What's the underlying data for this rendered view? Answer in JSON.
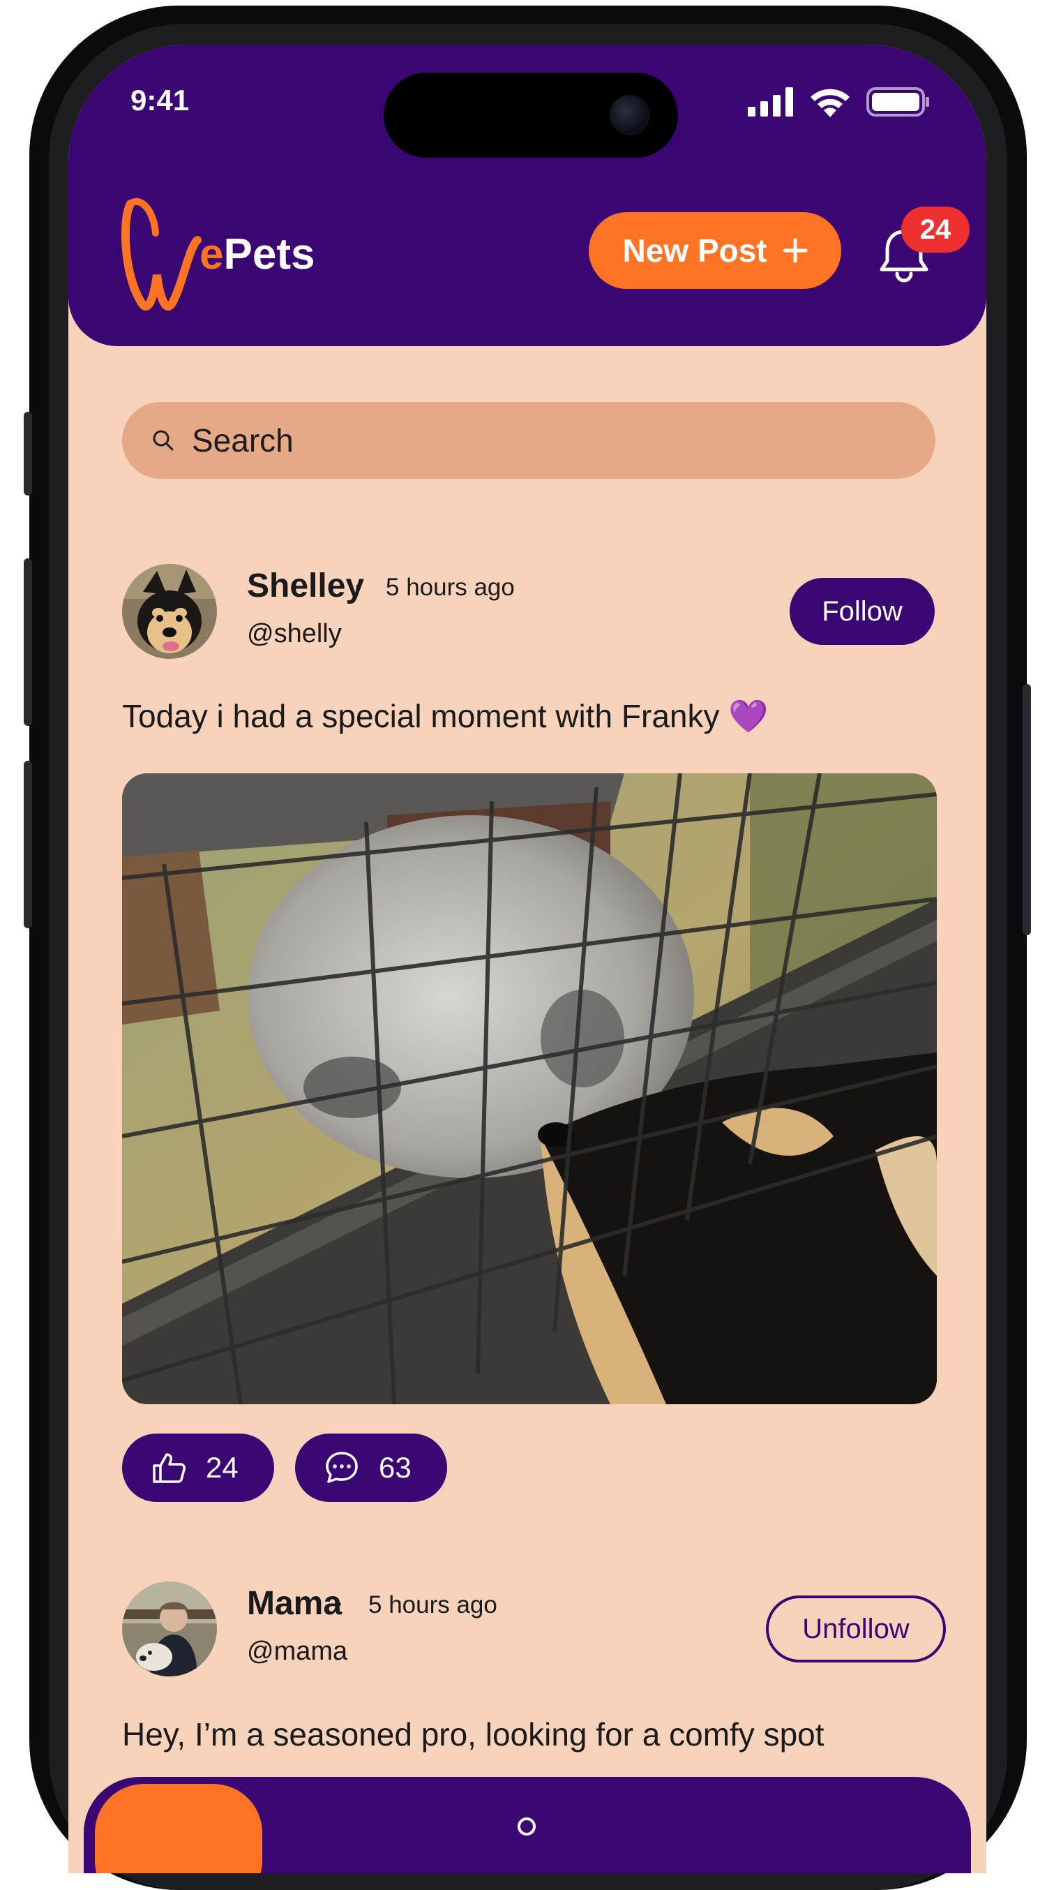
{
  "status_bar": {
    "time": "9:41"
  },
  "header": {
    "logo_text_we": "We",
    "logo_text_e": "e",
    "logo_text_pets": "Pets",
    "new_post_label": "New Post",
    "notification_count": "24"
  },
  "search": {
    "placeholder": "Search"
  },
  "posts": [
    {
      "name": "Shelley",
      "separator": "·",
      "time": "5 hours ago",
      "handle": "@shelly",
      "follow_label": "Follow",
      "text": "Today i had a special moment with Franky 💜",
      "likes": "24",
      "comments": "63"
    },
    {
      "name": "Mama",
      "separator": "·",
      "time": "5 hours ago",
      "handle": "@mama",
      "follow_label": "Unfollow",
      "text": "Hey, I’m a seasoned pro, looking for a comfy spot"
    }
  ],
  "colors": {
    "primary": "#3A0674",
    "accent": "#FF7424",
    "background": "#F8D3BC",
    "search_bg": "#E6A985",
    "badge": "#EE3030"
  },
  "icons": [
    "signal-icon",
    "wifi-icon",
    "battery-icon",
    "plus-icon",
    "bell-icon",
    "search-icon",
    "thumbs-up-icon",
    "comment-icon"
  ]
}
